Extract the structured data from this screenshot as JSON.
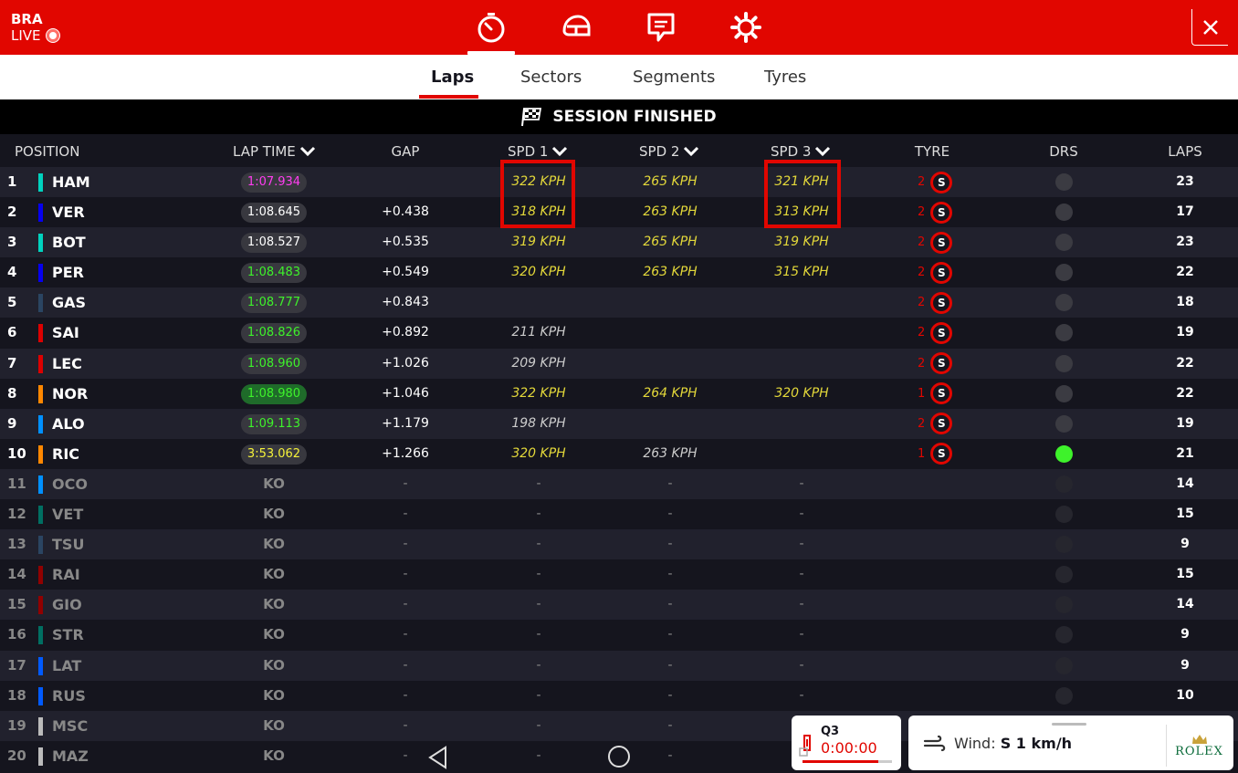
{
  "header": {
    "circuit": "BRA",
    "live_label": "LIVE",
    "icons": [
      "timing-icon",
      "helmet-icon",
      "race-control-icon",
      "settings-icon"
    ],
    "accent": "#e10600"
  },
  "tabs": [
    {
      "label": "Laps",
      "active": true
    },
    {
      "label": "Sectors",
      "active": false
    },
    {
      "label": "Segments",
      "active": false
    },
    {
      "label": "Tyres",
      "active": false
    }
  ],
  "banner": {
    "text": "SESSION FINISHED"
  },
  "columns": {
    "position": "POSITION",
    "lap_time": "LAP TIME",
    "gap": "GAP",
    "spd1": "SPD 1",
    "spd2": "SPD 2",
    "spd3": "SPD 3",
    "tyre": "TYRE",
    "drs": "DRS",
    "laps": "LAPS"
  },
  "rows": [
    {
      "pos": "1",
      "driver": "HAM",
      "team_color": "#00d2be",
      "lap_time": "1:07.934",
      "lap_color": "#ff3df0",
      "gap": "",
      "spd1": "322 KPH",
      "spd1_color": "#e3d83a",
      "spd2": "265 KPH",
      "spd2_color": "#e3d83a",
      "spd3": "321 KPH",
      "spd3_color": "#e3d83a",
      "tyre_laps": "2",
      "tyre": "S",
      "drs": false,
      "laps": "23",
      "ko": false
    },
    {
      "pos": "2",
      "driver": "VER",
      "team_color": "#0600ef",
      "lap_time": "1:08.645",
      "lap_color": "#ffffff",
      "gap": "+0.438",
      "spd1": "318 KPH",
      "spd1_color": "#e3d83a",
      "spd2": "263 KPH",
      "spd2_color": "#e3d83a",
      "spd3": "313 KPH",
      "spd3_color": "#e3d83a",
      "tyre_laps": "2",
      "tyre": "S",
      "drs": false,
      "laps": "17",
      "ko": false
    },
    {
      "pos": "3",
      "driver": "BOT",
      "team_color": "#00d2be",
      "lap_time": "1:08.527",
      "lap_color": "#ffffff",
      "gap": "+0.535",
      "spd1": "319 KPH",
      "spd1_color": "#e3d83a",
      "spd2": "265 KPH",
      "spd2_color": "#e3d83a",
      "spd3": "319 KPH",
      "spd3_color": "#e3d83a",
      "tyre_laps": "2",
      "tyre": "S",
      "drs": false,
      "laps": "23",
      "ko": false
    },
    {
      "pos": "4",
      "driver": "PER",
      "team_color": "#0600ef",
      "lap_time": "1:08.483",
      "lap_color": "#3ef22b",
      "gap": "+0.549",
      "spd1": "320 KPH",
      "spd1_color": "#e3d83a",
      "spd2": "263 KPH",
      "spd2_color": "#e3d83a",
      "spd3": "315 KPH",
      "spd3_color": "#e3d83a",
      "tyre_laps": "2",
      "tyre": "S",
      "drs": false,
      "laps": "22",
      "ko": false
    },
    {
      "pos": "5",
      "driver": "GAS",
      "team_color": "#2b4562",
      "lap_time": "1:08.777",
      "lap_color": "#3ef22b",
      "gap": "+0.843",
      "spd1": "",
      "spd1_color": "#e3d83a",
      "spd2": "",
      "spd2_color": "#e3d83a",
      "spd3": "",
      "spd3_color": "#e3d83a",
      "tyre_laps": "2",
      "tyre": "S",
      "drs": false,
      "laps": "18",
      "ko": false
    },
    {
      "pos": "6",
      "driver": "SAI",
      "team_color": "#dc0000",
      "lap_time": "1:08.826",
      "lap_color": "#3ef22b",
      "gap": "+0.892",
      "spd1": "211 KPH",
      "spd1_color": "#cccccc",
      "spd2": "",
      "spd2_color": "#e3d83a",
      "spd3": "",
      "spd3_color": "#e3d83a",
      "tyre_laps": "2",
      "tyre": "S",
      "drs": false,
      "laps": "19",
      "ko": false
    },
    {
      "pos": "7",
      "driver": "LEC",
      "team_color": "#dc0000",
      "lap_time": "1:08.960",
      "lap_color": "#3ef22b",
      "gap": "+1.026",
      "spd1": "209 KPH",
      "spd1_color": "#cccccc",
      "spd2": "",
      "spd2_color": "#e3d83a",
      "spd3": "",
      "spd3_color": "#e3d83a",
      "tyre_laps": "2",
      "tyre": "S",
      "drs": false,
      "laps": "22",
      "ko": false
    },
    {
      "pos": "8",
      "driver": "NOR",
      "team_color": "#ff8700",
      "lap_time": "1:08.980",
      "lap_color": "#3ef22b",
      "gap": "+1.046",
      "spd1": "322 KPH",
      "spd1_color": "#e3d83a",
      "spd2": "264 KPH",
      "spd2_color": "#e3d83a",
      "spd3": "320 KPH",
      "spd3_color": "#e3d83a",
      "tyre_laps": "1",
      "tyre": "S",
      "drs": false,
      "laps": "22",
      "ko": false,
      "lap_pill_green": true
    },
    {
      "pos": "9",
      "driver": "ALO",
      "team_color": "#0090ff",
      "lap_time": "1:09.113",
      "lap_color": "#3ef22b",
      "gap": "+1.179",
      "spd1": "198 KPH",
      "spd1_color": "#cccccc",
      "spd2": "",
      "spd2_color": "#e3d83a",
      "spd3": "",
      "spd3_color": "#e3d83a",
      "tyre_laps": "2",
      "tyre": "S",
      "drs": false,
      "laps": "19",
      "ko": false
    },
    {
      "pos": "10",
      "driver": "RIC",
      "team_color": "#ff8700",
      "lap_time": "3:53.062",
      "lap_color": "#f5f23a",
      "gap": "+1.266",
      "spd1": "320 KPH",
      "spd1_color": "#e3d83a",
      "spd2": "263 KPH",
      "spd2_color": "#cccccc",
      "spd3": "",
      "spd3_color": "#e3d83a",
      "tyre_laps": "1",
      "tyre": "S",
      "drs": true,
      "laps": "21",
      "ko": false
    },
    {
      "pos": "11",
      "driver": "OCO",
      "team_color": "#0090ff",
      "lap_time": "KO",
      "gap": "-",
      "spd1": "-",
      "spd2": "-",
      "spd3": "-",
      "drs": false,
      "laps": "14",
      "ko": true
    },
    {
      "pos": "12",
      "driver": "VET",
      "team_color": "#006f62",
      "lap_time": "KO",
      "gap": "-",
      "spd1": "-",
      "spd2": "-",
      "spd3": "-",
      "drs": false,
      "laps": "15",
      "ko": true
    },
    {
      "pos": "13",
      "driver": "TSU",
      "team_color": "#2b4562",
      "lap_time": "KO",
      "gap": "-",
      "spd1": "-",
      "spd2": "-",
      "spd3": "-",
      "drs": false,
      "laps": "9",
      "ko": true
    },
    {
      "pos": "14",
      "driver": "RAI",
      "team_color": "#900000",
      "lap_time": "KO",
      "gap": "-",
      "spd1": "-",
      "spd2": "-",
      "spd3": "-",
      "drs": false,
      "laps": "15",
      "ko": true
    },
    {
      "pos": "15",
      "driver": "GIO",
      "team_color": "#900000",
      "lap_time": "KO",
      "gap": "-",
      "spd1": "-",
      "spd2": "-",
      "spd3": "-",
      "drs": false,
      "laps": "14",
      "ko": true
    },
    {
      "pos": "16",
      "driver": "STR",
      "team_color": "#006f62",
      "lap_time": "KO",
      "gap": "-",
      "spd1": "-",
      "spd2": "-",
      "spd3": "-",
      "drs": true,
      "laps": "9",
      "ko": true
    },
    {
      "pos": "17",
      "driver": "LAT",
      "team_color": "#005aff",
      "lap_time": "KO",
      "gap": "-",
      "spd1": "-",
      "spd2": "-",
      "spd3": "-",
      "drs": false,
      "laps": "9",
      "ko": true
    },
    {
      "pos": "18",
      "driver": "RUS",
      "team_color": "#005aff",
      "lap_time": "KO",
      "gap": "-",
      "spd1": "-",
      "spd2": "-",
      "spd3": "-",
      "drs": false,
      "laps": "10",
      "ko": true
    },
    {
      "pos": "19",
      "driver": "MSC",
      "team_color": "#bbbbbb",
      "lap_time": "KO",
      "gap": "-",
      "spd1": "-",
      "spd2": "-",
      "spd3": "-",
      "drs": false,
      "laps": "",
      "ko": true
    },
    {
      "pos": "20",
      "driver": "MAZ",
      "team_color": "#bbbbbb",
      "lap_time": "KO",
      "gap": "-",
      "spd1": "-",
      "spd2": "-",
      "spd3": "-",
      "drs": false,
      "laps": "",
      "ko": true
    }
  ],
  "session_card": {
    "label": "Q3",
    "time": "0:00:00",
    "progress": 0.85
  },
  "weather_card": {
    "wind_label": "Wind:",
    "wind_value": "S 1 km/h",
    "sponsor": "ROLEX"
  },
  "nav": {
    "icons": [
      "back-icon",
      "home-icon"
    ]
  }
}
